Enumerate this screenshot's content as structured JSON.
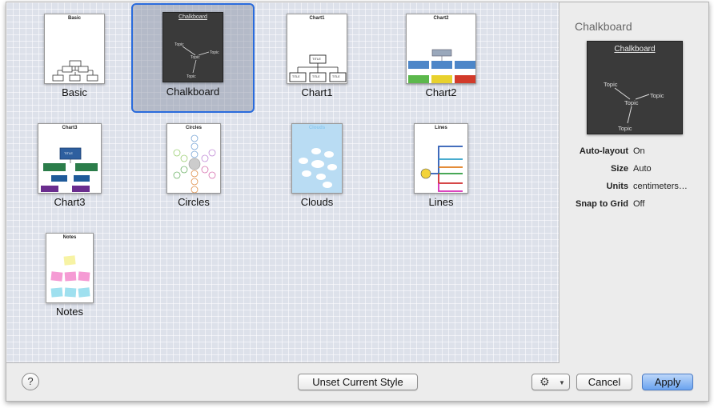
{
  "window": {
    "accent_color": "#2a6bdc"
  },
  "styles": [
    {
      "label": "Basic",
      "thumb_title": "Basic",
      "selected": false
    },
    {
      "label": "Chalkboard",
      "thumb_title": "Chalkboard",
      "selected": true
    },
    {
      "label": "Chart1",
      "thumb_title": "Chart1",
      "selected": false
    },
    {
      "label": "Chart2",
      "thumb_title": "Chart2",
      "selected": false
    },
    {
      "label": "Chart3",
      "thumb_title": "Chart3",
      "selected": false
    },
    {
      "label": "Circles",
      "thumb_title": "Circles",
      "selected": false
    },
    {
      "label": "Clouds",
      "thumb_title": "Clouds",
      "selected": false
    },
    {
      "label": "Lines",
      "thumb_title": "Lines",
      "selected": false
    },
    {
      "label": "Notes",
      "thumb_title": "Notes",
      "selected": false
    }
  ],
  "side_panel": {
    "title": "Chalkboard",
    "preview_title": "Chalkboard",
    "preview_topics": [
      "Topic",
      "Topic",
      "Topic",
      "Topic"
    ],
    "properties": [
      {
        "key": "Auto-layout",
        "value": "On"
      },
      {
        "key": "Size",
        "value": "Auto"
      },
      {
        "key": "Units",
        "value": "centimeters…"
      },
      {
        "key": "Snap to Grid",
        "value": "Off"
      }
    ]
  },
  "thumb_text": {
    "chart_title": "TITLE",
    "topic": "Topic"
  },
  "bottom_bar": {
    "help_label": "?",
    "unset_label": "Unset Current Style",
    "gear_icon": "gear-icon",
    "cancel_label": "Cancel",
    "apply_label": "Apply"
  }
}
